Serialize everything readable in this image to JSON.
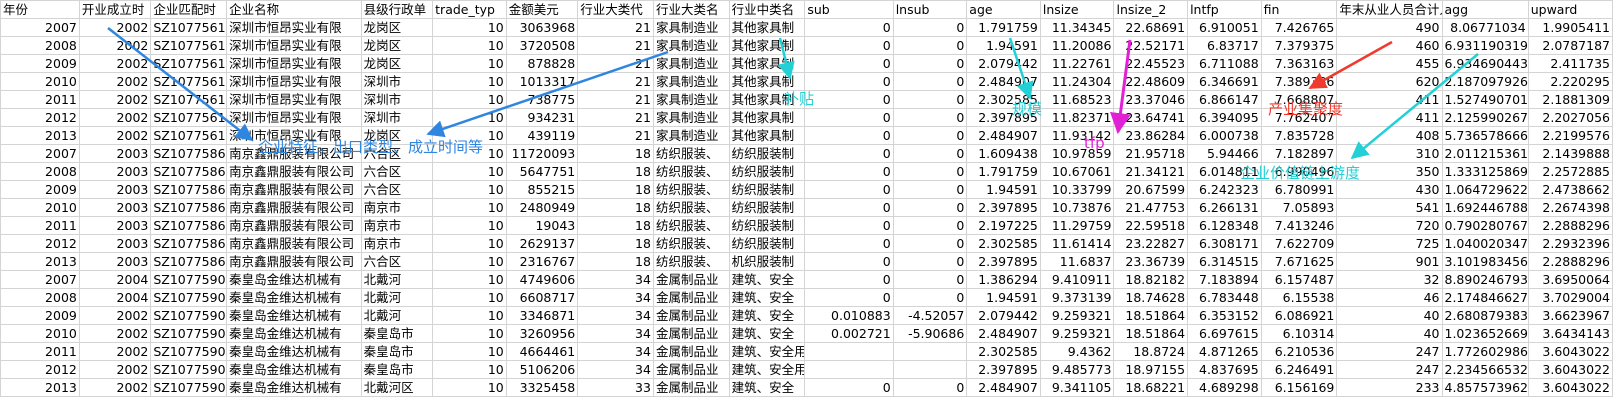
{
  "headers": [
    "年份",
    "开业成立时",
    "企业匹配时",
    "企业名称",
    "县级行政单",
    "trade_typ",
    "金额美元",
    "行业大类代",
    "行业大类名",
    "行业中类名",
    "sub",
    "lnsub",
    "age",
    "lnsize",
    "lnsize_2",
    "lntfp",
    "fin",
    "年末从业人员合计人",
    "agg",
    "upward"
  ],
  "rows": [
    [
      "2007",
      "2002",
      "SZ1077561",
      "深圳市恒昂实业有限",
      "龙岗区",
      "10",
      "3063968",
      "21",
      "家具制造业",
      "其他家具制",
      "0",
      "0",
      "1.791759",
      "11.34345",
      "22.68691",
      "6.910051",
      "7.426765",
      "490",
      "8.06771034",
      "1.9905411"
    ],
    [
      "2008",
      "2002",
      "SZ1077561",
      "深圳市恒昂实业有限",
      "龙岗区",
      "10",
      "3720508",
      "21",
      "家具制造业",
      "其他家具制",
      "0",
      "0",
      "1.94591",
      "11.20086",
      "22.52171",
      "6.83717",
      "7.379375",
      "460",
      "6.931190319",
      "2.0787187"
    ],
    [
      "2009",
      "2002",
      "SZ1077561",
      "深圳市恒昂实业有限",
      "龙岗区",
      "10",
      "878828",
      "21",
      "家具制造业",
      "其他家具制",
      "0",
      "0",
      "2.079442",
      "11.22761",
      "22.45523",
      "6.711088",
      "7.363163",
      "455",
      "6.934690443",
      "2.411735"
    ],
    [
      "2010",
      "2002",
      "SZ1077561",
      "深圳市恒昂实业有限",
      "深圳市",
      "10",
      "1013317",
      "21",
      "家具制造业",
      "其他家具制",
      "0",
      "0",
      "2.484907",
      "11.24304",
      "22.48609",
      "6.346691",
      "7.389386",
      "620",
      "2.187097926",
      "2.220295"
    ],
    [
      "2011",
      "2002",
      "SZ1077561",
      "深圳市恒昂实业有限",
      "深圳市",
      "10",
      "738775",
      "21",
      "家具制造业",
      "其他家具制",
      "0",
      "0",
      "2.302585",
      "11.68523",
      "23.37046",
      "6.866147",
      "7.668807",
      "411",
      "1.527490701",
      "2.1881309"
    ],
    [
      "2012",
      "2002",
      "SZ1077561",
      "深圳市恒昂实业有限",
      "深圳市",
      "10",
      "934231",
      "21",
      "家具制造业",
      "其他家具制",
      "0",
      "0",
      "2.397895",
      "11.82371",
      "23.64741",
      "6.394095",
      "7.762407",
      "411",
      "2.125990267",
      "2.2027056"
    ],
    [
      "2013",
      "2002",
      "SZ1077561",
      "深圳市恒昂实业有限",
      "龙岗区",
      "10",
      "439119",
      "21",
      "家具制造业",
      "其他家具制",
      "0",
      "0",
      "2.484907",
      "11.93142",
      "23.86284",
      "6.000738",
      "7.835728",
      "408",
      "5.736578666",
      "2.2199576"
    ],
    [
      "2007",
      "2003",
      "SZ1077586",
      "南京鑫鼎服装有限公司",
      "六合区",
      "10",
      "11720093",
      "18",
      "纺织服装、",
      "纺织服装制",
      "0",
      "0",
      "1.609438",
      "10.97859",
      "21.95718",
      "5.94466",
      "7.182897",
      "310",
      "2.011215361",
      "2.1439888"
    ],
    [
      "2008",
      "2003",
      "SZ1077586",
      "南京鑫鼎服装有限公司",
      "六合区",
      "10",
      "5647751",
      "18",
      "纺织服装、",
      "纺织服装制",
      "0",
      "0",
      "1.791759",
      "10.67061",
      "21.34121",
      "6.014811",
      "6.990496",
      "350",
      "1.333125869",
      "2.2572885"
    ],
    [
      "2009",
      "2003",
      "SZ1077586",
      "南京鑫鼎服装有限公司",
      "六合区",
      "10",
      "855215",
      "18",
      "纺织服装、",
      "纺织服装制",
      "0",
      "0",
      "1.94591",
      "10.33799",
      "20.67599",
      "6.242323",
      "6.780991",
      "430",
      "1.064729622",
      "2.4738662"
    ],
    [
      "2010",
      "2003",
      "SZ1077586",
      "南京鑫鼎服装有限公司",
      "南京市",
      "10",
      "2480949",
      "18",
      "纺织服装、",
      "纺织服装制",
      "0",
      "0",
      "2.397895",
      "10.73876",
      "21.47753",
      "6.266131",
      "7.05893",
      "541",
      "1.692446788",
      "2.2674398"
    ],
    [
      "2011",
      "2003",
      "SZ1077586",
      "南京鑫鼎服装有限公司",
      "南京市",
      "10",
      "19043",
      "18",
      "纺织服装、",
      "纺织服装制",
      "0",
      "0",
      "2.197225",
      "11.29759",
      "22.59518",
      "6.128348",
      "7.413246",
      "720",
      "0.790280767",
      "2.2888296"
    ],
    [
      "2012",
      "2003",
      "SZ1077586",
      "南京鑫鼎服装有限公司",
      "南京市",
      "10",
      "2629137",
      "18",
      "纺织服装、",
      "纺织服装制",
      "0",
      "0",
      "2.302585",
      "11.61414",
      "23.22827",
      "6.308171",
      "7.622709",
      "725",
      "1.040020347",
      "2.2932396"
    ],
    [
      "2013",
      "2003",
      "SZ1077586",
      "南京鑫鼎服装有限公司",
      "六合区",
      "10",
      "2316767",
      "18",
      "纺织服装、",
      "机织服装制",
      "0",
      "0",
      "2.397895",
      "11.6837",
      "23.36739",
      "6.314515",
      "7.671625",
      "901",
      "3.101983456",
      "2.2888296"
    ],
    [
      "2007",
      "2004",
      "SZ1077590",
      "秦皇岛金维达机械有",
      "北戴河",
      "10",
      "4749606",
      "34",
      "金属制品业",
      "建筑、安全",
      "0",
      "0",
      "1.386294",
      "9.410911",
      "18.82182",
      "7.183894",
      "6.157487",
      "32",
      "8.890246793",
      "3.6950064"
    ],
    [
      "2008",
      "2004",
      "SZ1077590",
      "秦皇岛金维达机械有",
      "北戴河",
      "10",
      "6608717",
      "34",
      "金属制品业",
      "建筑、安全",
      "0",
      "0",
      "1.94591",
      "9.373139",
      "18.74628",
      "6.783448",
      "6.15538",
      "46",
      "2.174846627",
      "3.7029004"
    ],
    [
      "2009",
      "2002",
      "SZ1077590",
      "秦皇岛金维达机械有",
      "北戴河",
      "10",
      "3346871",
      "34",
      "金属制品业",
      "建筑、安全",
      "0.010883",
      "-4.52057",
      "2.079442",
      "9.259321",
      "18.51864",
      "6.353152",
      "6.086921",
      "40",
      "2.680879383",
      "3.6623967"
    ],
    [
      "2010",
      "2002",
      "SZ1077590",
      "秦皇岛金维达机械有",
      "秦皇岛市",
      "10",
      "3260956",
      "34",
      "金属制品业",
      "建筑、安全",
      "0.002721",
      "-5.90686",
      "2.484907",
      "9.259321",
      "18.51864",
      "6.697615",
      "6.10314",
      "40",
      "1.023652669",
      "3.6434143"
    ],
    [
      "2011",
      "2002",
      "SZ1077590",
      "秦皇岛金维达机械有",
      "秦皇岛市",
      "10",
      "4664461",
      "34",
      "金属制品业",
      "建筑、安全用金属制品制造",
      "",
      "",
      "2.302585",
      "9.4362",
      "18.8724",
      "4.871265",
      "6.210536",
      "247",
      "1.772602986",
      "3.6043022"
    ],
    [
      "2012",
      "2002",
      "SZ1077590",
      "秦皇岛金维达机械有",
      "秦皇岛市",
      "10",
      "5106206",
      "34",
      "金属制品业",
      "建筑、安全用金属制品制造",
      "",
      "",
      "2.397895",
      "9.485773",
      "18.97155",
      "4.837695",
      "6.246491",
      "247",
      "2.234566532",
      "3.6043022"
    ],
    [
      "2013",
      "2002",
      "SZ1077590",
      "秦皇岛金维达机械有",
      "北戴河区",
      "10",
      "3325458",
      "33",
      "金属制品业",
      "建筑、安全",
      "0",
      "0",
      "2.484907",
      "9.341105",
      "18.68221",
      "4.689298",
      "6.156169",
      "233",
      "4.857573962",
      "3.6043022"
    ]
  ],
  "annotations": {
    "firm_features": "企业特征，出口类型、成立时间等",
    "subsidy": "补贴",
    "scale": "规模",
    "tfp": "tfp",
    "agglomeration": "产业集聚度",
    "upstreamness": "企业价值链上游度"
  },
  "colors": {
    "blue_arrow": "#2f86e0",
    "cyan_arrow": "#22d0d6",
    "magenta_arrow": "#e221d6",
    "red_arrow": "#f03a2e",
    "grid_line": "#d4d4d4"
  }
}
